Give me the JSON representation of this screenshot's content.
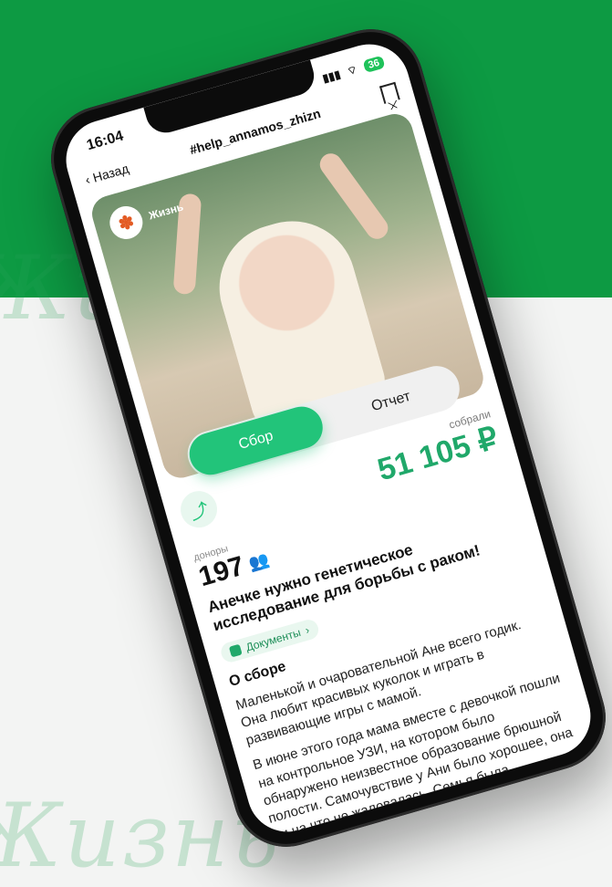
{
  "background": {
    "brand_green": "#0d9a43",
    "script_text": "Жизнь"
  },
  "status_bar": {
    "time": "16:04",
    "battery": "36"
  },
  "nav": {
    "back_label": "Назад",
    "title": "#help_annamos_zhizn",
    "back_icon": "chevron-left-icon",
    "bookmark_icon": "bookmark-icon"
  },
  "photo": {
    "org_name": "Жизнь"
  },
  "tabs": [
    {
      "label": "Сбор",
      "active": true
    },
    {
      "label": "Отчет",
      "active": false
    }
  ],
  "summary": {
    "collected_label": "собрали",
    "collected_value": "51 105 ₽",
    "donors_label": "доноры",
    "donors_value": "197",
    "share_icon": "share-icon"
  },
  "headline": "Анечке нужно генетическое исследование для борьбы с раком!",
  "documents": {
    "label": "Документы"
  },
  "about": {
    "title": "О сборе",
    "p1": "Маленькой и очаровательной Ане всего годик. Она любит красивых куколок и играть в развивающие игры с мамой.",
    "p2": "В июне этого года мама вместе с девочкой пошли на контрольное УЗИ, на котором было обнаружено неизвестное образование брюшной полости. Самочувствие у Ани было хорошее, она ни на что не жаловалась. Семья была шокирована и не могла поверить, что у"
  },
  "colors": {
    "accent": "#22c47a",
    "accent_dark": "#20a86a"
  }
}
